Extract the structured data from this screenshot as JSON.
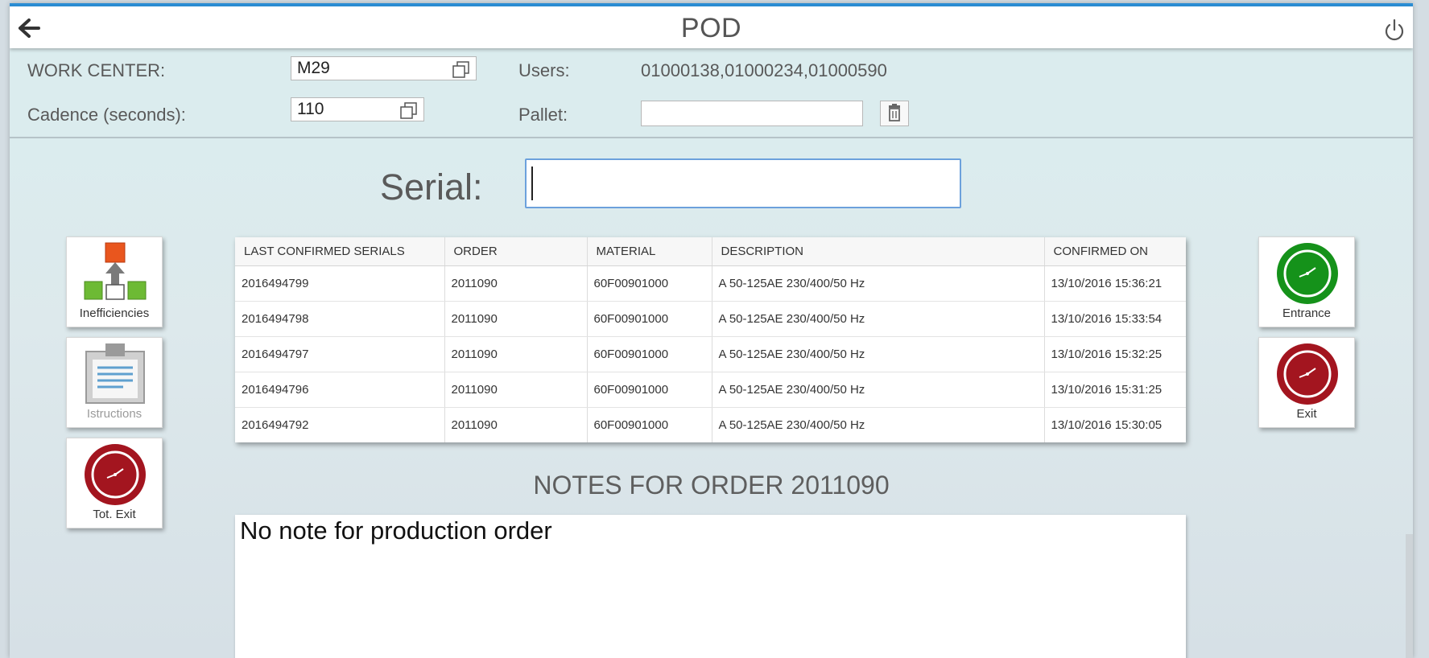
{
  "app": {
    "title": "POD"
  },
  "header": {
    "work_center_label": "WORK CENTER:",
    "work_center_value": "M29",
    "cadence_label": "Cadence (seconds):",
    "cadence_value": "110",
    "users_label": "Users:",
    "users_value": "01000138,01000234,01000590",
    "pallet_label": "Pallet:",
    "pallet_value": ""
  },
  "serial": {
    "label": "Serial:",
    "value": ""
  },
  "left_tiles": [
    {
      "label": "Inefficiencies",
      "icon": "inefficiencies-icon",
      "enabled": true
    },
    {
      "label": "Istructions",
      "icon": "clipboard-icon",
      "enabled": false
    },
    {
      "label": "Tot. Exit",
      "icon": "clock-red-icon",
      "enabled": true
    }
  ],
  "right_tiles": [
    {
      "label": "Entrance",
      "icon": "clock-green-icon",
      "enabled": true
    },
    {
      "label": "Exit",
      "icon": "clock-red-icon",
      "enabled": true
    }
  ],
  "table": {
    "columns": [
      "LAST CONFIRMED SERIALS",
      "ORDER",
      "MATERIAL",
      "DESCRIPTION",
      "CONFIRMED ON"
    ],
    "rows": [
      [
        "2016494799",
        "2011090",
        "60F00901000",
        "A 50-125AE 230/400/50 Hz",
        "13/10/2016 15:36:21"
      ],
      [
        "2016494798",
        "2011090",
        "60F00901000",
        "A 50-125AE 230/400/50 Hz",
        "13/10/2016 15:33:54"
      ],
      [
        "2016494797",
        "2011090",
        "60F00901000",
        "A 50-125AE 230/400/50 Hz",
        "13/10/2016 15:32:25"
      ],
      [
        "2016494796",
        "2011090",
        "60F00901000",
        "A 50-125AE 230/400/50 Hz",
        "13/10/2016 15:31:25"
      ],
      [
        "2016494792",
        "2011090",
        "60F00901000",
        "A 50-125AE 230/400/50 Hz",
        "13/10/2016 15:30:05"
      ]
    ]
  },
  "notes": {
    "title": "NOTES FOR ORDER 2011090",
    "text": "No note for production order"
  },
  "colors": {
    "accent": "#2b8ed4",
    "clock_green": "#15921a",
    "clock_red": "#a3151f",
    "tile_orange": "#e9561e",
    "tile_green": "#6dba34"
  }
}
